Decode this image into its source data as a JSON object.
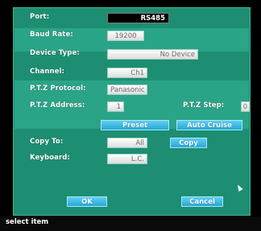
{
  "port": {
    "label": "Port:",
    "value": "RS485"
  },
  "baud_rate": {
    "label": "Baud Rate:",
    "value": "19200"
  },
  "device_type": {
    "label": "Device Type:",
    "value": "No Device"
  },
  "channel": {
    "label": "Channel:",
    "value": "Ch1"
  },
  "ptz_protocol": {
    "label": "P.T.Z Protocol:",
    "value": "Panasonic"
  },
  "ptz_address": {
    "label": "P.T.Z Address:",
    "value": "1"
  },
  "ptz_step": {
    "label": "P.T.Z Step:",
    "value": "0"
  },
  "buttons": {
    "preset": "Preset",
    "auto_cruise": "Auto Cruise",
    "copy": "Copy",
    "ok": "OK",
    "cancel": "Cancel"
  },
  "copy_to": {
    "label": "Copy To:",
    "value": "All"
  },
  "keyboard": {
    "label": "Keyboard:",
    "value": "L.C."
  },
  "status_bar": {
    "text": "select item"
  },
  "colors": {
    "panel": "#1d8e72",
    "band": "#2aa486",
    "button": "#3fb9e6",
    "status_bar": "#0a0a0a"
  }
}
